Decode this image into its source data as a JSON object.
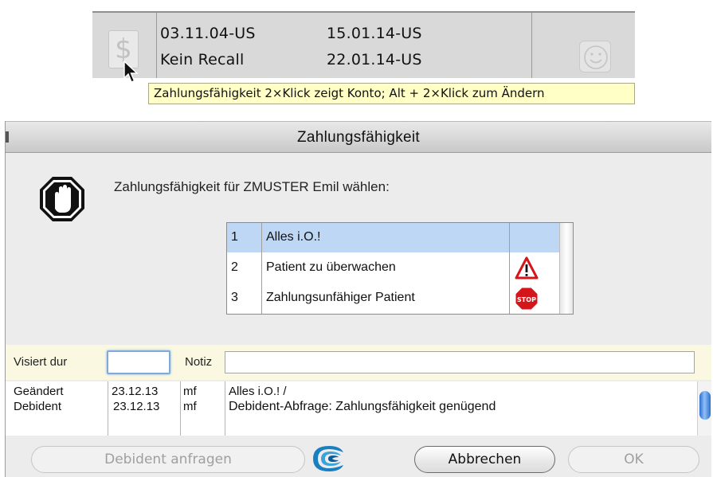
{
  "strip": {
    "date_1": "03.11.04-US",
    "recall_text": "Kein Recall",
    "date_2": "15.01.14-US",
    "date_3": "22.01.14-US",
    "dollar_symbol": "$",
    "tooltip": "Zahlungsfähigkeit  2×Klick zeigt Konto; Alt + 2×Klick zum Ändern"
  },
  "dialog": {
    "title": "Zahlungsfähigkeit",
    "prompt": "Zahlungsfähigkeit für ZMUSTER Emil wählen:",
    "options": [
      {
        "num": "1",
        "label": "Alles i.O.!",
        "icon": "none",
        "selected": true
      },
      {
        "num": "2",
        "label": "Patient zu überwachen",
        "icon": "warning-triangle-icon",
        "selected": false
      },
      {
        "num": "3",
        "label": "Zahlungsunfähiger Patient",
        "icon": "stop-sign-icon",
        "selected": false
      }
    ],
    "stop_sign_text": "STOP",
    "visiert_label": "Visiert dur",
    "visiert_value": "",
    "notiz_label": "Notiz",
    "notiz_value": "",
    "history": [
      {
        "type": "Geändert",
        "date": "23.12.13",
        "user": "mf",
        "text": "Alles i.O.! /"
      },
      {
        "type": "Debident",
        "date": "23.12.13",
        "user": "mf",
        "text": "Debident-Abfrage: Zahlungsfähigkeit genügend"
      }
    ],
    "buttons": {
      "debident": "Debident anfragen",
      "cancel": "Abbrechen",
      "ok": "OK"
    }
  },
  "colors": {
    "selection": "#bdd7f5",
    "tooltip_bg": "#ffffc6",
    "visier_row_bg": "#fbf8e2",
    "focus_ring": "#7fa9dc"
  }
}
